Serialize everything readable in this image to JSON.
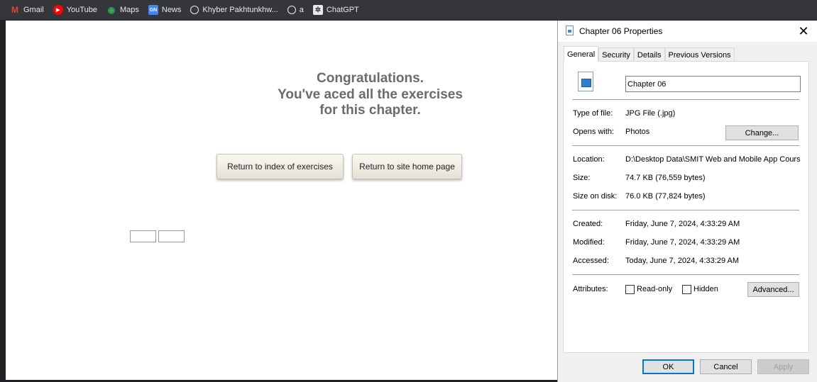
{
  "bookmarks": [
    {
      "label": "Gmail",
      "icon": "gmail-icon",
      "glyph": "M"
    },
    {
      "label": "YouTube",
      "icon": "youtube-icon",
      "glyph": "▶"
    },
    {
      "label": "Maps",
      "icon": "maps-pin-icon",
      "glyph": "◉"
    },
    {
      "label": "News",
      "icon": "news-icon",
      "glyph": "GN"
    },
    {
      "label": "Khyber Pakhtunkhw...",
      "icon": "globe-icon",
      "glyph": ""
    },
    {
      "label": "a",
      "icon": "globe-icon",
      "glyph": ""
    },
    {
      "label": "ChatGPT",
      "icon": "chatgpt-icon",
      "glyph": "✲"
    }
  ],
  "page": {
    "congrats_lines": [
      "Congratulations.",
      "You've aced all the exercises",
      "for this chapter."
    ],
    "return_index_label": "Return to index of exercises",
    "return_home_label": "Return to site home page"
  },
  "dialog": {
    "title": "Chapter 06 Properties",
    "close_glyph": "✕",
    "tabs": [
      "General",
      "Security",
      "Details",
      "Previous Versions"
    ],
    "active_tab": "General",
    "file_name": "Chapter 06",
    "type_label": "Type of file:",
    "type_value": "JPG File (.jpg)",
    "opens_label": "Opens with:",
    "opens_value": "Photos",
    "change_label": "Change...",
    "location_label": "Location:",
    "location_value": "D:\\Desktop Data\\SMIT Web and Mobile App Cours",
    "size_label": "Size:",
    "size_value": "74.7 KB (76,559 bytes)",
    "size_disk_label": "Size on disk:",
    "size_disk_value": "76.0 KB (77,824 bytes)",
    "created_label": "Created:",
    "created_value": "Friday, June 7, 2024, 4:33:29 AM",
    "modified_label": "Modified:",
    "modified_value": "Friday, June 7, 2024, 4:33:29 AM",
    "accessed_label": "Accessed:",
    "accessed_value": "Today, June 7, 2024, 4:33:29 AM",
    "attributes_label": "Attributes:",
    "readonly_label": "Read-only",
    "readonly_checked": false,
    "hidden_label": "Hidden",
    "hidden_checked": false,
    "advanced_label": "Advanced...",
    "ok_label": "OK",
    "cancel_label": "Cancel",
    "apply_label": "Apply"
  }
}
